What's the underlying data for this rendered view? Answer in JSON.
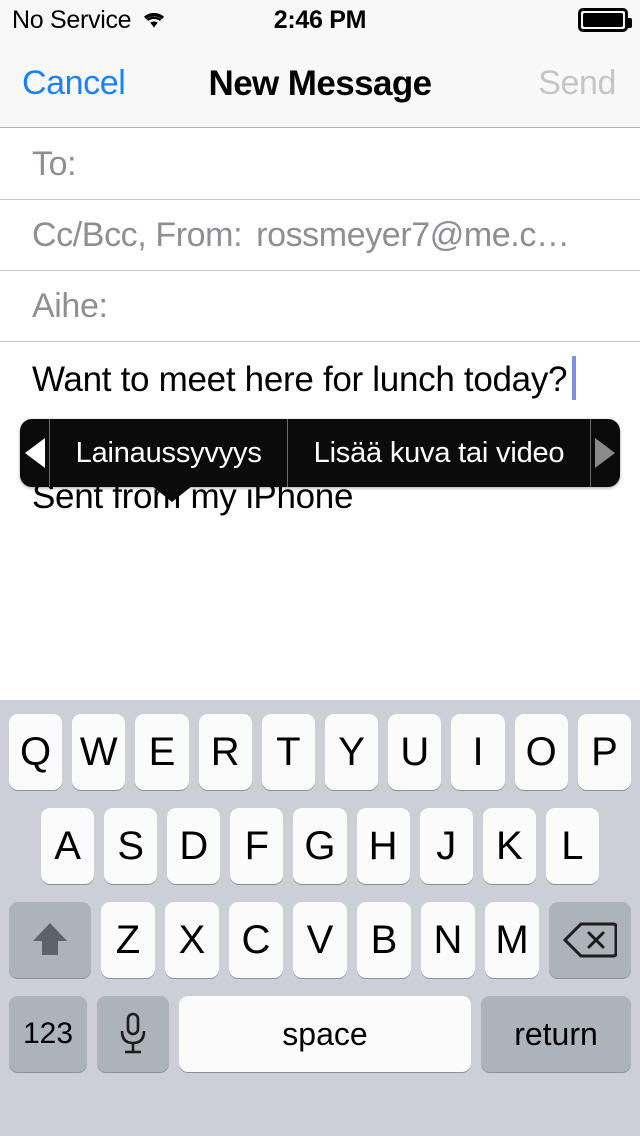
{
  "status_bar": {
    "carrier": "No Service",
    "wifi_icon": "wifi-icon",
    "time": "2:46 PM",
    "battery_icon": "battery-full-icon",
    "battery_level": 100
  },
  "nav_bar": {
    "cancel_label": "Cancel",
    "title": "New Message",
    "send_label": "Send",
    "cancel_color": "#1b82ff",
    "send_color": "#c5c5c5"
  },
  "compose": {
    "to": {
      "label": "To:",
      "value": "",
      "placeholder": "To:"
    },
    "ccbcc": {
      "label": "Cc/Bcc, From:",
      "value": "rossmeyer7@me.c…"
    },
    "subject": {
      "label": "Aihe:",
      "value": "",
      "placeholder": "Aihe:"
    },
    "body": {
      "text": "Want to meet here for lunch today?",
      "caret_color": "#7a93d6",
      "signature": "Sent from my iPhone"
    }
  },
  "edit_menu": {
    "prev_arrow_icon": "triangle-left-icon",
    "next_arrow_icon": "triangle-right-icon",
    "items": [
      {
        "label": "Lainaussyvyys"
      },
      {
        "label": "Lisää kuva tai video"
      }
    ],
    "background": "#0b0b0b",
    "text_color": "#ffffff"
  },
  "keyboard": {
    "background": "#ccd0d6",
    "rows": [
      {
        "keys": [
          "Q",
          "W",
          "E",
          "R",
          "T",
          "Y",
          "U",
          "I",
          "O",
          "P"
        ]
      },
      {
        "keys": [
          "A",
          "S",
          "D",
          "F",
          "G",
          "H",
          "J",
          "K",
          "L"
        ]
      },
      {
        "keys": [
          "Z",
          "X",
          "C",
          "V",
          "B",
          "N",
          "M"
        ]
      }
    ],
    "shift_icon": "shift-up-arrow-icon",
    "delete_icon": "backspace-delete-icon",
    "numeric_label": "123",
    "dictation_icon": "microphone-icon",
    "space_label": "space",
    "return_label": "return"
  }
}
